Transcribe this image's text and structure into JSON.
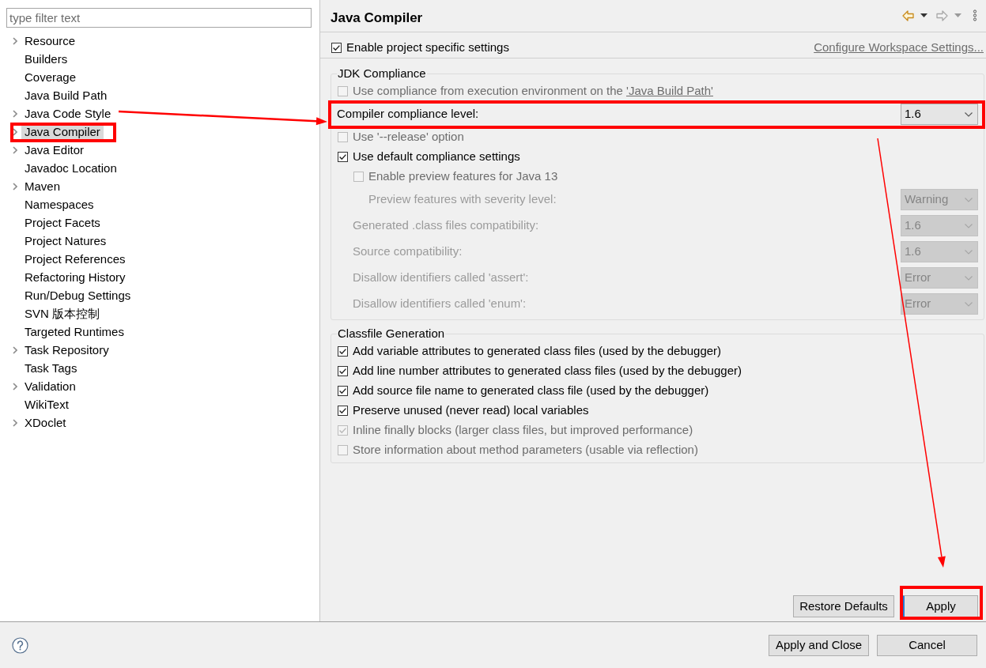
{
  "filter": {
    "placeholder": "type filter text"
  },
  "tree": [
    {
      "label": "Resource",
      "expandable": true,
      "expanded": false,
      "selected": false,
      "highlighted": false
    },
    {
      "label": "Builders",
      "expandable": false,
      "selected": false,
      "highlighted": false
    },
    {
      "label": "Coverage",
      "expandable": false,
      "selected": false,
      "highlighted": false
    },
    {
      "label": "Java Build Path",
      "expandable": false,
      "selected": false,
      "highlighted": false
    },
    {
      "label": "Java Code Style",
      "expandable": true,
      "expanded": false,
      "selected": false,
      "highlighted": false
    },
    {
      "label": "Java Compiler",
      "expandable": true,
      "expanded": false,
      "selected": true,
      "highlighted": true
    },
    {
      "label": "Java Editor",
      "expandable": true,
      "expanded": false,
      "selected": false,
      "highlighted": false
    },
    {
      "label": "Javadoc Location",
      "expandable": false,
      "selected": false,
      "highlighted": false
    },
    {
      "label": "Maven",
      "expandable": true,
      "expanded": false,
      "selected": false,
      "highlighted": false
    },
    {
      "label": "Namespaces",
      "expandable": false,
      "selected": false,
      "highlighted": false
    },
    {
      "label": "Project Facets",
      "expandable": false,
      "selected": false,
      "highlighted": false
    },
    {
      "label": "Project Natures",
      "expandable": false,
      "selected": false,
      "highlighted": false
    },
    {
      "label": "Project References",
      "expandable": false,
      "selected": false,
      "highlighted": false
    },
    {
      "label": "Refactoring History",
      "expandable": false,
      "selected": false,
      "highlighted": false
    },
    {
      "label": "Run/Debug Settings",
      "expandable": false,
      "selected": false,
      "highlighted": false
    },
    {
      "label": "SVN 版本控制",
      "expandable": false,
      "selected": false,
      "highlighted": false
    },
    {
      "label": "Targeted Runtimes",
      "expandable": false,
      "selected": false,
      "highlighted": false
    },
    {
      "label": "Task Repository",
      "expandable": true,
      "expanded": false,
      "selected": false,
      "highlighted": false
    },
    {
      "label": "Task Tags",
      "expandable": false,
      "selected": false,
      "highlighted": false
    },
    {
      "label": "Validation",
      "expandable": true,
      "expanded": false,
      "selected": false,
      "highlighted": false
    },
    {
      "label": "WikiText",
      "expandable": false,
      "selected": false,
      "highlighted": false
    },
    {
      "label": "XDoclet",
      "expandable": true,
      "expanded": false,
      "selected": false,
      "highlighted": false
    }
  ],
  "page": {
    "title": "Java Compiler",
    "nav": [
      {
        "kind": "back",
        "disabled": false
      },
      {
        "kind": "forward",
        "disabled": true
      }
    ],
    "project_settings": {
      "label": "Enable project specific settings",
      "checked": true
    },
    "workspace_link": "Configure Workspace Settings...",
    "groups": [
      {
        "title": "JDK Compliance",
        "rows": [
          {
            "kind": "checkbox",
            "label": "Use compliance from execution environment on the",
            "link": "'Java Build Path'",
            "checked": false,
            "disabled": true,
            "highlighted": false
          },
          {
            "kind": "select",
            "label": "Compiler compliance level:",
            "value": "1.6",
            "disabled": false,
            "highlighted": true
          },
          {
            "kind": "checkbox",
            "label": "Use '--release' option",
            "checked": false,
            "disabled": true,
            "highlighted": false
          },
          {
            "kind": "checkbox",
            "label": "Use default compliance settings",
            "checked": true,
            "disabled": false,
            "highlighted": false,
            "children": [
              {
                "kind": "checkbox",
                "label": "Enable preview features for Java 13",
                "checked": false,
                "disabled": true,
                "children": [
                  {
                    "kind": "select",
                    "label": "Preview features with severity level:",
                    "value": "Warning",
                    "disabled": true
                  }
                ]
              },
              {
                "kind": "select",
                "label": "Generated .class files compatibility:",
                "value": "1.6",
                "disabled": true
              },
              {
                "kind": "select",
                "label": "Source compatibility:",
                "value": "1.6",
                "disabled": true
              },
              {
                "kind": "select",
                "label": "Disallow identifiers called 'assert':",
                "value": "Error",
                "disabled": true
              },
              {
                "kind": "select",
                "label": "Disallow identifiers called 'enum':",
                "value": "Error",
                "disabled": true
              }
            ]
          }
        ]
      },
      {
        "title": "Classfile Generation",
        "rows": [
          {
            "kind": "checkbox",
            "label": "Add variable attributes to generated class files (used by the debugger)",
            "checked": true,
            "disabled": false
          },
          {
            "kind": "checkbox",
            "label": "Add line number attributes to generated class files (used by the debugger)",
            "checked": true,
            "disabled": false
          },
          {
            "kind": "checkbox",
            "label": "Add source file name to generated class file (used by the debugger)",
            "checked": true,
            "disabled": false
          },
          {
            "kind": "checkbox",
            "label": "Preserve unused (never read) local variables",
            "checked": true,
            "disabled": false
          },
          {
            "kind": "checkbox",
            "label": "Inline finally blocks (larger class files, but improved performance)",
            "checked": true,
            "disabled": true
          },
          {
            "kind": "checkbox",
            "label": "Store information about method parameters (usable via reflection)",
            "checked": false,
            "disabled": true
          }
        ]
      }
    ],
    "buttons": [
      {
        "label": "Restore Defaults",
        "focused": false,
        "highlighted": false
      },
      {
        "label": "Apply",
        "focused": true,
        "highlighted": true
      }
    ]
  },
  "dialog_buttons": [
    {
      "label": "Apply and Close"
    },
    {
      "label": "Cancel"
    }
  ]
}
